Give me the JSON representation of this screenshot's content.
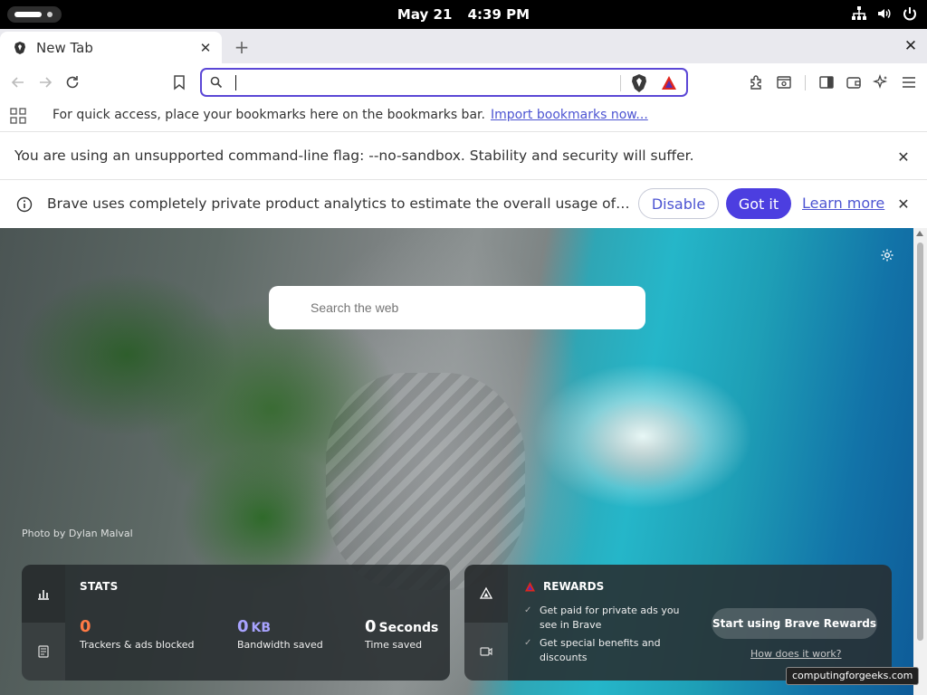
{
  "system": {
    "date": "May 21",
    "time": "4:39 PM"
  },
  "tab": {
    "title": "New Tab"
  },
  "omnibox": {
    "value": "",
    "placeholder": ""
  },
  "bookmarks_bar": {
    "message": "For quick access, place your bookmarks here on the bookmarks bar.",
    "link": "Import bookmarks now..."
  },
  "infobar_sandbox": {
    "text": "You are using an unsupported command-line flag: --no-sandbox. Stability and security will suffer."
  },
  "infobar_analytics": {
    "text": "Brave uses completely private product analytics to estimate the overall usage of ce...",
    "disable": "Disable",
    "got_it": "Got it",
    "learn_more": "Learn more"
  },
  "ntp": {
    "search_placeholder": "Search the web",
    "photo_credit": "Photo by Dylan Malval"
  },
  "stats": {
    "title": "STATS",
    "trackers": {
      "value": "0",
      "label": "Trackers & ads blocked"
    },
    "bandwidth": {
      "value": "0",
      "unit": "KB",
      "label": "Bandwidth saved"
    },
    "time": {
      "value": "0",
      "unit": "Seconds",
      "label": "Time saved"
    }
  },
  "rewards": {
    "title": "REWARDS",
    "items": [
      "Get paid for private ads you see in Brave",
      "Get special benefits and discounts"
    ],
    "button": "Start using Brave Rewards",
    "link": "How does it work?"
  },
  "watermark": "computingforgeeks.com",
  "colors": {
    "accent": "#4c3ee0",
    "link": "#4c54d2",
    "omnibox_border": "#5b47d6"
  }
}
